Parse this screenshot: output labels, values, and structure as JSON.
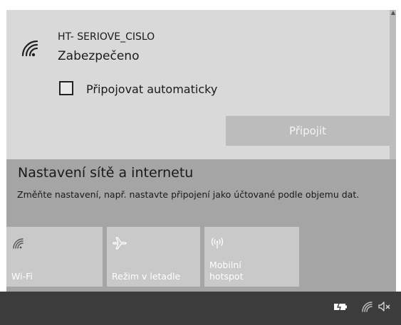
{
  "network": {
    "name": "HT- SERIOVE_CISLO",
    "status": "Zabezpečeno",
    "auto_connect_label": "Připojovat automaticky",
    "auto_connect_checked": false,
    "connect_label": "Připojit"
  },
  "settings": {
    "title": "Nastavení sítě a internetu",
    "description": "Změňte nastavení, např. nastavte připojení jako účtované podle objemu dat."
  },
  "quick_actions": [
    {
      "label": "Wi-Fi",
      "icon": "wifi-icon"
    },
    {
      "label": "Režim v letadle",
      "icon": "airplane-icon"
    },
    {
      "label": "Mobilní hotspot",
      "icon": "hotspot-icon"
    }
  ],
  "tray": {
    "icons": [
      "battery-charging-icon",
      "wifi-icon",
      "speaker-muted-icon"
    ]
  },
  "colors": {
    "network_item_bg": "#d9d9d9",
    "panel_bg": "#a5a5a5",
    "tile_bg": "#c9c9c9",
    "taskbar_bg": "#3c3c3c"
  }
}
